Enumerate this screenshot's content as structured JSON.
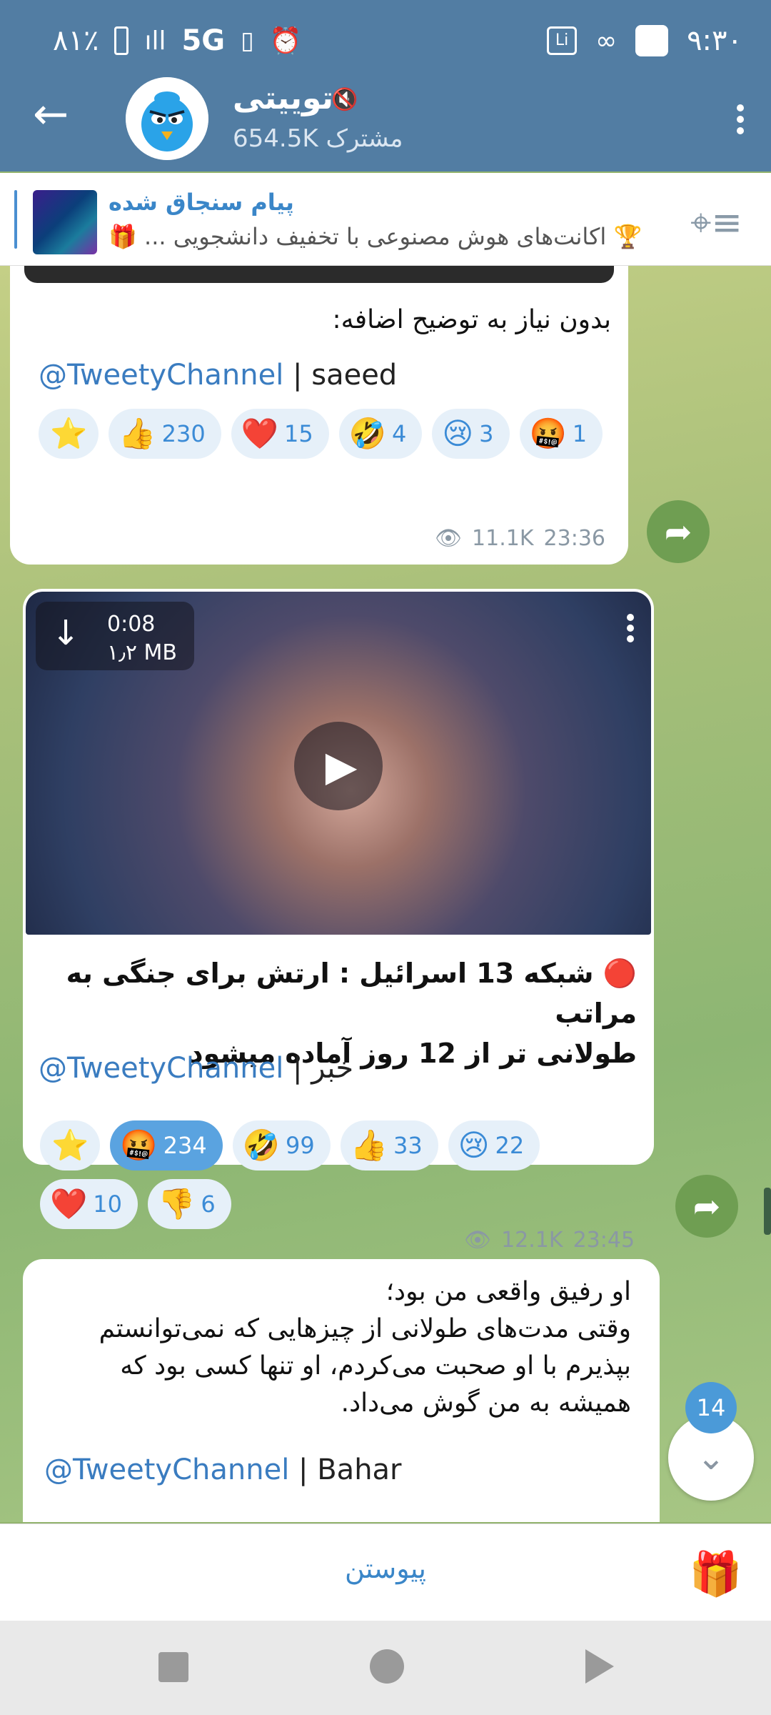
{
  "status_bar": {
    "battery": "٨١٪",
    "network": "5G",
    "time": "٩:٣٠",
    "icons": [
      "battery-icon",
      "signal-icon",
      "vibrate-icon",
      "alarm-icon",
      "li-icon",
      "link-icon",
      "square-icon"
    ]
  },
  "header": {
    "back_icon": "arrow-left-icon",
    "title": "تو‌ییتی",
    "subscribers": "654.5K مشترک",
    "mute_icon": "mute-icon",
    "menu_icon": "more-vertical-icon"
  },
  "pinned": {
    "title": "پیام سنجاق شده",
    "text": "اکانت‌های هوش مصنوعی با تخفیف دانشجویی ...",
    "icon": "pin-list-icon"
  },
  "messages": [
    {
      "text": "بدون نیاز به توضیح اضافه:",
      "handle": "@TweetyChannel",
      "sig_sep": " | ",
      "sig_tail": "saeed",
      "reactions": [
        {
          "emoji": "⭐",
          "count": ""
        },
        {
          "emoji": "👍",
          "count": "230"
        },
        {
          "emoji": "❤️",
          "count": "15"
        },
        {
          "emoji": "🤣",
          "count": "4"
        },
        {
          "emoji": "😢",
          "count": "3"
        },
        {
          "emoji": "🤬",
          "count": "1"
        }
      ],
      "views": "11.1K",
      "time": "23:36"
    },
    {
      "video": {
        "duration": "0:08",
        "size": "۱٫۲ MB"
      },
      "text_line1": "🔴 شبکه 13 اسرائیل :  ارتش برای جنگی به مراتب",
      "text_line2": "طولانی تر از 12 روز آماده میشود",
      "handle": "@TweetyChannel",
      "sig_sep": " | ",
      "sig_tail": "خبر",
      "reactions": [
        {
          "emoji": "⭐",
          "count": ""
        },
        {
          "emoji": "🤬",
          "count": "234"
        },
        {
          "emoji": "🤣",
          "count": "99"
        },
        {
          "emoji": "👍",
          "count": "33"
        },
        {
          "emoji": "😢",
          "count": "22"
        },
        {
          "emoji": "❤️",
          "count": "10"
        },
        {
          "emoji": "👎",
          "count": "6"
        }
      ],
      "views": "12.1K",
      "time": "23:45"
    },
    {
      "lines": [
        "او رفیق واقعی من بود؛",
        "وقتی مدت‌های طولانی از چیزهایی که نمی‌توانستم",
        "بپذیرم با او صحبت می‌کردم، او تنها کسی بود که",
        "همیشه به من گوش می‌داد."
      ],
      "handle": "@TweetyChannel",
      "sig_sep": " | ",
      "sig_tail": "Bahar"
    }
  ],
  "unread_badge": "14",
  "join_label": "پیوستن",
  "colors": {
    "header": "#527da3",
    "accent": "#3a86c8",
    "chip_bg": "#e6f0f9",
    "chip_selected": "#5aa3e0"
  }
}
